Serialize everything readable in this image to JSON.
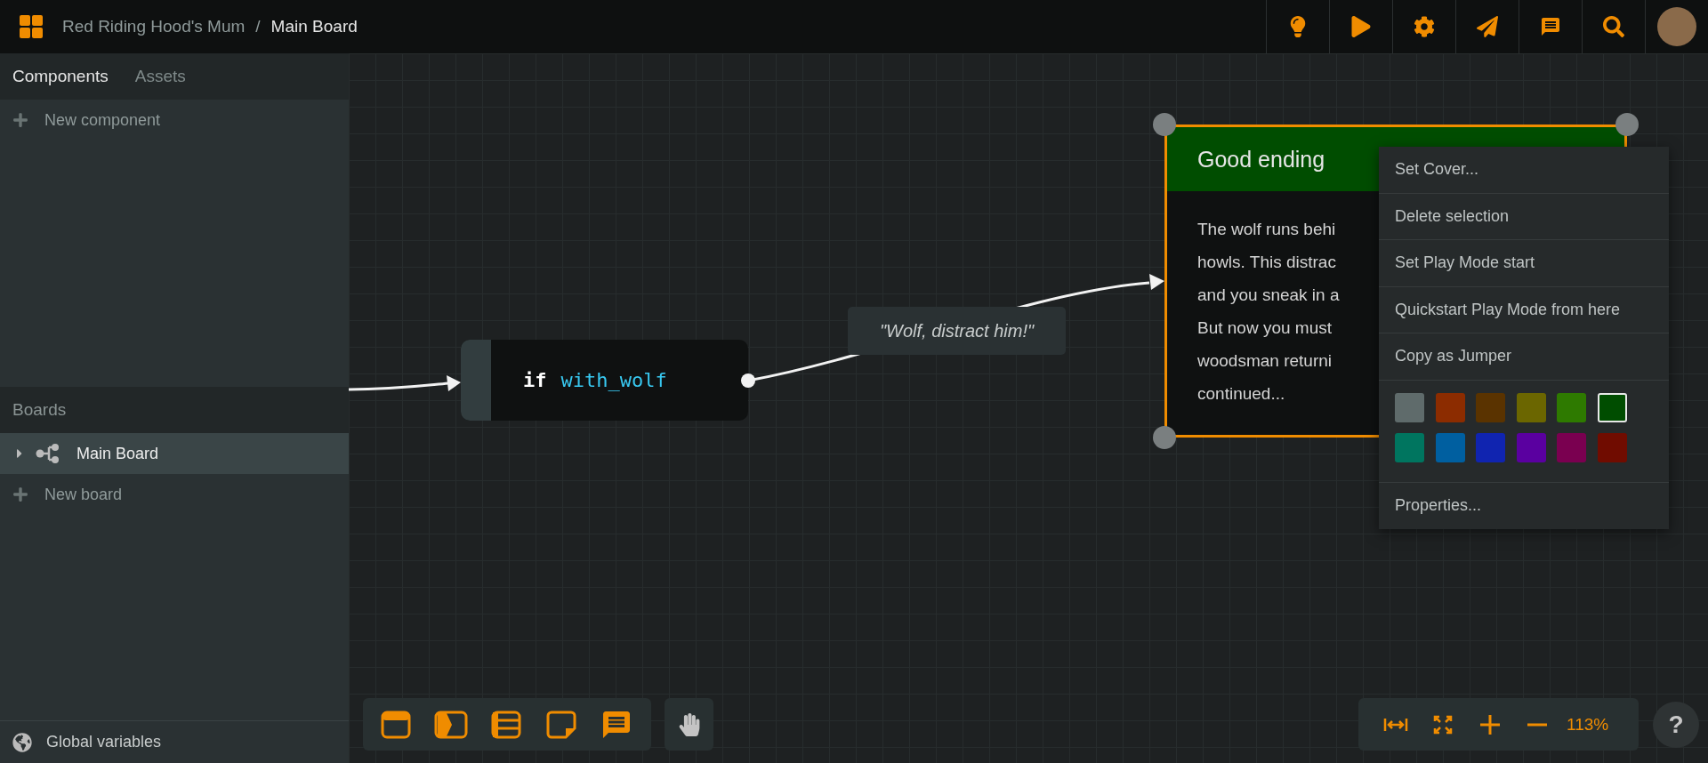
{
  "topbar": {
    "breadcrumb": [
      {
        "label": "Red Riding Hood's Mum",
        "current": false
      },
      {
        "label": "Main Board",
        "current": true
      }
    ],
    "separator": "/"
  },
  "sidebar": {
    "tabs": [
      {
        "label": "Components",
        "selected": true
      },
      {
        "label": "Assets",
        "selected": false
      }
    ],
    "new_component": "New component",
    "boards_header": "Boards",
    "boards": [
      {
        "label": "Main Board",
        "selected": true,
        "expanded": false
      }
    ],
    "new_board": "New board",
    "footer": "Global variables"
  },
  "canvas": {
    "condition": {
      "keyword": "if",
      "variable": "with_wolf"
    },
    "edge_label": "\"Wolf, distract him!\"",
    "card": {
      "title": "Good ending",
      "selected": true,
      "lines": [
        "The wolf runs behi",
        "howls. This distrac",
        "and you sneak in a",
        "But now you must",
        "woodsman returni",
        "continued..."
      ]
    }
  },
  "context_menu": {
    "items": [
      "Set Cover...",
      "Delete selection",
      "Set Play Mode start",
      "Quickstart Play Mode from here",
      "Copy as Jumper"
    ],
    "swatches": [
      {
        "color": "#5f6b6b",
        "selected": false
      },
      {
        "color": "#8c2c00",
        "selected": false
      },
      {
        "color": "#5a3300",
        "selected": false
      },
      {
        "color": "#6b6600",
        "selected": false
      },
      {
        "color": "#2e7a00",
        "selected": false
      },
      {
        "color": "#004d00",
        "selected": true
      },
      {
        "color": "#00755f",
        "selected": false
      },
      {
        "color": "#005fa0",
        "selected": false
      },
      {
        "color": "#1024b0",
        "selected": false
      },
      {
        "color": "#5a00a0",
        "selected": false
      },
      {
        "color": "#7a0050",
        "selected": false
      },
      {
        "color": "#700c00",
        "selected": false
      }
    ],
    "footer_items": [
      "Properties..."
    ]
  },
  "zoom": {
    "reading": "113%"
  },
  "help": "?"
}
